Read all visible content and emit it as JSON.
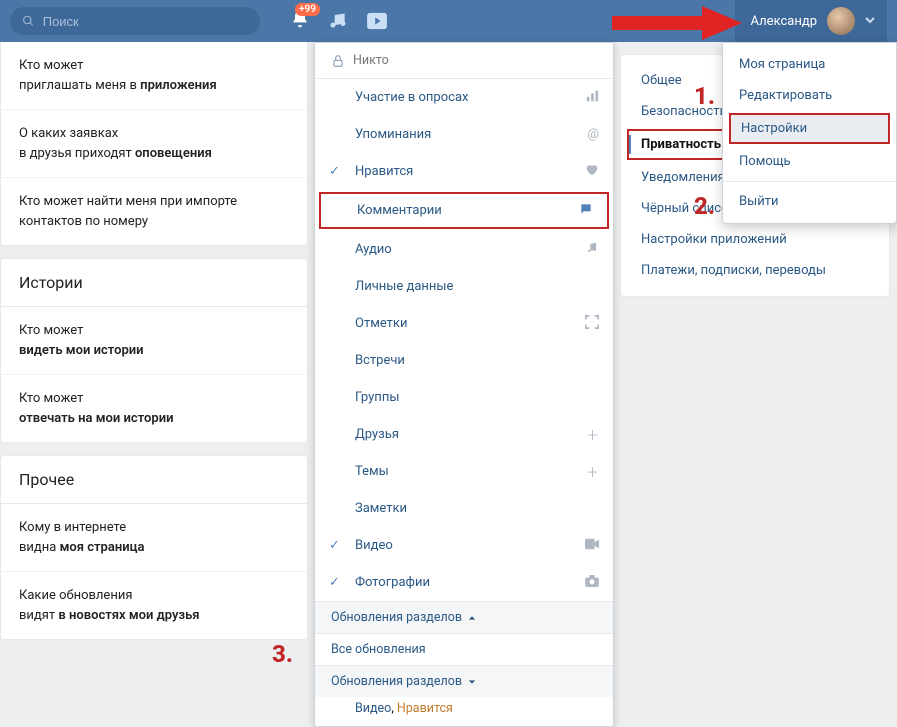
{
  "header": {
    "search_placeholder": "Поиск",
    "notification_badge": "+99",
    "user_name": "Александр"
  },
  "arrow_color": "#e02424",
  "left": {
    "top_rows": [
      {
        "prefix": "Кто может",
        "suffix_pre": "приглашать меня в ",
        "strong": "приложения"
      },
      {
        "prefix": "О каких заявках",
        "suffix_pre": "в друзья приходят ",
        "strong": "оповещения"
      },
      {
        "prefix": "Кто может найти меня при импорте",
        "suffix_pre": "контактов по номеру",
        "strong": ""
      }
    ],
    "stories_title": "Истории",
    "stories_rows": [
      {
        "prefix": "Кто может",
        "strong": "видеть мои истории"
      },
      {
        "prefix": "Кто может",
        "strong": "отвечать на мои истории"
      }
    ],
    "other_title": "Прочее",
    "other_rows": [
      {
        "prefix": "Кому в интернете",
        "suffix_pre": "видна ",
        "strong": "моя страница"
      },
      {
        "prefix": "Какие обновления",
        "suffix_pre": "видят ",
        "strong": "в новостях мои друзья"
      }
    ]
  },
  "dropdown": {
    "top_label": "Никто",
    "items": [
      {
        "label": "Участие в опросах",
        "icon": "bars"
      },
      {
        "label": "Упоминания",
        "icon": "at"
      },
      {
        "label": "Нравится",
        "icon": "heart",
        "checked": true
      },
      {
        "label": "Комментарии",
        "icon": "comment",
        "highlight": true
      },
      {
        "label": "Аудио",
        "icon": "music"
      },
      {
        "label": "Личные данные",
        "icon": ""
      },
      {
        "label": "Отметки",
        "icon": "fullscreen"
      },
      {
        "label": "Встречи",
        "icon": ""
      },
      {
        "label": "Группы",
        "icon": ""
      },
      {
        "label": "Друзья",
        "icon": "plus"
      },
      {
        "label": "Темы",
        "icon": "plus"
      },
      {
        "label": "Заметки",
        "icon": ""
      },
      {
        "label": "Видео",
        "icon": "video",
        "checked": true
      },
      {
        "label": "Фотографии",
        "icon": "camera",
        "checked": true
      }
    ],
    "cat1": "Обновления разделов",
    "sub": "Все обновления",
    "cat2": "Обновления разделов",
    "tags": {
      "t1": "Видео",
      "t2": "Нравится"
    }
  },
  "right_menu": {
    "items": [
      {
        "label": "Общее"
      },
      {
        "label": "Безопасность"
      },
      {
        "label": "Приватность",
        "active": true,
        "highlight": true
      },
      {
        "label": "Уведомления"
      },
      {
        "label": "Чёрный список"
      },
      {
        "label": "Настройки приложений"
      },
      {
        "label": "Платежи, подписки, переводы"
      }
    ]
  },
  "user_popup": {
    "items": [
      {
        "label": "Моя страница"
      },
      {
        "label": "Редактировать"
      },
      {
        "label": "Настройки",
        "highlight": true,
        "selected": true
      },
      {
        "label": "Помощь"
      }
    ],
    "exit": "Выйти"
  },
  "markers": {
    "one": "1.",
    "two": "2.",
    "three": "3."
  }
}
